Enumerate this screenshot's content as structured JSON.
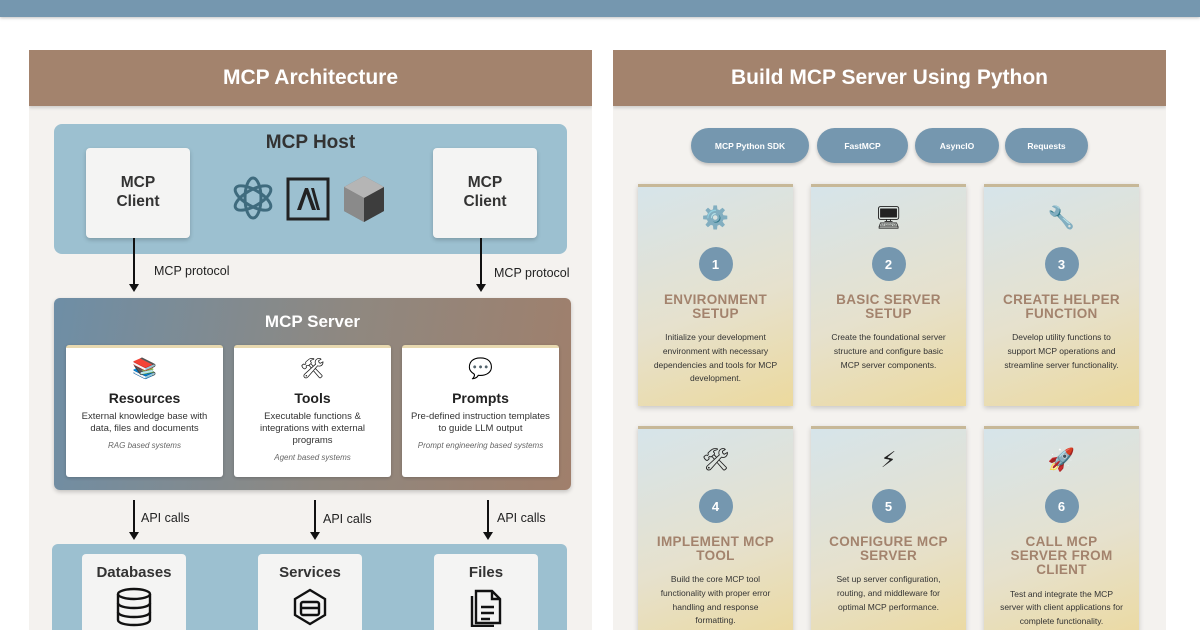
{
  "left": {
    "title": "MCP Architecture",
    "host": {
      "title": "MCP Host",
      "client_left": "MCP\nClient",
      "client_right": "MCP\nClient",
      "logos": [
        "openai-logo",
        "anthropic-logo",
        "perplexity-logo"
      ]
    },
    "protocol_left": "MCP protocol",
    "protocol_right": "MCP protocol",
    "server": {
      "title": "MCP Server",
      "cards": [
        {
          "icon": "books-icon",
          "glyph": "📚",
          "title": "Resources",
          "desc": "External knowledge base with data, files and documents",
          "note": "RAG based systems"
        },
        {
          "icon": "tools-icon",
          "glyph": "🛠",
          "title": "Tools",
          "desc": "Executable functions & integrations with external programs",
          "note": "Agent based systems"
        },
        {
          "icon": "speech-bubble-icon",
          "glyph": "💬",
          "title": "Prompts",
          "desc": "Pre-defined instruction templates to guide LLM output",
          "note": "Prompt engineering based systems"
        }
      ]
    },
    "api_labels": [
      "API calls",
      "API calls",
      "API calls"
    ],
    "backends": [
      "Databases",
      "Services",
      "Files"
    ]
  },
  "right": {
    "title": "Build MCP Server Using Python",
    "pills": [
      "MCP Python SDK",
      "FastMCP",
      "AsyncIO",
      "Requests"
    ],
    "steps": [
      {
        "icon": "gear-icon",
        "glyph": "⚙️",
        "num": "1",
        "title": "ENVIRONMENT\nSETUP",
        "desc": "Initialize your development environment with necessary dependencies and tools for MCP development."
      },
      {
        "icon": "computer-icon",
        "glyph": "🖥",
        "num": "2",
        "title": "BASIC SERVER\nSETUP",
        "desc": "Create the foundational server structure and configure basic MCP server components."
      },
      {
        "icon": "wrench-icon",
        "glyph": "🔧",
        "num": "3",
        "title": "CREATE HELPER\nFUNCTION",
        "desc": "Develop utility functions to support MCP operations and streamline server functionality."
      },
      {
        "icon": "tools-icon",
        "glyph": "🛠",
        "num": "4",
        "title": "IMPLEMENT MCP\nTOOL",
        "desc": "Build the core MCP tool functionality with proper error handling and response formatting."
      },
      {
        "icon": "lightning-icon",
        "glyph": "⚡",
        "num": "5",
        "title": "CONFIGURE MCP\nSERVER",
        "desc": "Set up server configuration, routing, and middleware for optimal MCP performance."
      },
      {
        "icon": "rocket-icon",
        "glyph": "🚀",
        "num": "6",
        "title": "CALL MCP\nSERVER FROM\nCLIENT",
        "desc": "Test and integrate the MCP server with client applications for complete functionality."
      }
    ]
  },
  "colors": {
    "header_brown": "#a3836d",
    "accent_blue": "#7597af",
    "host_blue": "#9cc0d0"
  }
}
